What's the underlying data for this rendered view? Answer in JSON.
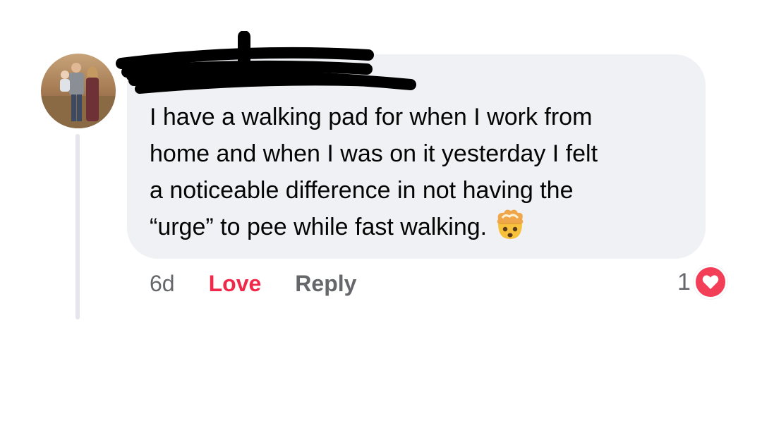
{
  "comment": {
    "author_name": "",
    "text_lines": [
      "I have a walking pad for when I work from",
      "home and when I was on it yesterday I felt",
      "a noticeable difference in not having the",
      "“urge” to pee while fast walking."
    ],
    "emoji": "exploding-head-emoji"
  },
  "actions": {
    "time": "6d",
    "love_label": "Love",
    "reply_label": "Reply"
  },
  "reactions": {
    "count": "1",
    "type": "heart-icon",
    "badge_color": "#f33e58"
  },
  "colors": {
    "bubble": "#f0f1f4",
    "love": "#f0284a",
    "secondary_text": "#65676b"
  }
}
